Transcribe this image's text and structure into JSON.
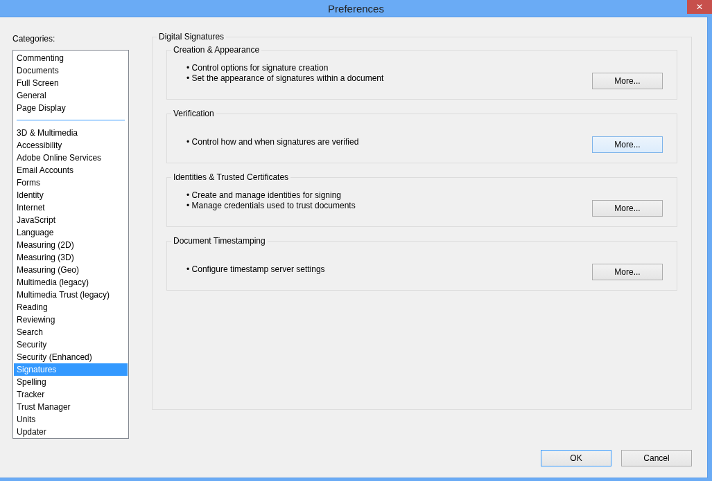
{
  "window": {
    "title": "Preferences",
    "close": "✕"
  },
  "categories": {
    "label": "Categories:",
    "groups": [
      {
        "items": [
          {
            "label": "Commenting",
            "selected": false
          },
          {
            "label": "Documents",
            "selected": false
          },
          {
            "label": "Full Screen",
            "selected": false
          },
          {
            "label": "General",
            "selected": false
          },
          {
            "label": "Page Display",
            "selected": false
          }
        ]
      },
      {
        "items": [
          {
            "label": "3D & Multimedia",
            "selected": false
          },
          {
            "label": "Accessibility",
            "selected": false
          },
          {
            "label": "Adobe Online Services",
            "selected": false
          },
          {
            "label": "Email Accounts",
            "selected": false
          },
          {
            "label": "Forms",
            "selected": false
          },
          {
            "label": "Identity",
            "selected": false
          },
          {
            "label": "Internet",
            "selected": false
          },
          {
            "label": "JavaScript",
            "selected": false
          },
          {
            "label": "Language",
            "selected": false
          },
          {
            "label": "Measuring (2D)",
            "selected": false
          },
          {
            "label": "Measuring (3D)",
            "selected": false
          },
          {
            "label": "Measuring (Geo)",
            "selected": false
          },
          {
            "label": "Multimedia (legacy)",
            "selected": false
          },
          {
            "label": "Multimedia Trust (legacy)",
            "selected": false
          },
          {
            "label": "Reading",
            "selected": false
          },
          {
            "label": "Reviewing",
            "selected": false
          },
          {
            "label": "Search",
            "selected": false
          },
          {
            "label": "Security",
            "selected": false
          },
          {
            "label": "Security (Enhanced)",
            "selected": false
          },
          {
            "label": "Signatures",
            "selected": true
          },
          {
            "label": "Spelling",
            "selected": false
          },
          {
            "label": "Tracker",
            "selected": false
          },
          {
            "label": "Trust Manager",
            "selected": false
          },
          {
            "label": "Units",
            "selected": false
          },
          {
            "label": "Updater",
            "selected": false
          }
        ]
      }
    ]
  },
  "panel": {
    "title": "Digital Signatures",
    "sections": [
      {
        "title": "Creation & Appearance",
        "lines": [
          "• Control options for signature creation",
          "• Set the appearance of signatures within a document"
        ],
        "button": {
          "label": "More...",
          "hovered": false
        }
      },
      {
        "title": "Verification",
        "lines": [
          "• Control how and when signatures are verified"
        ],
        "button": {
          "label": "More...",
          "hovered": true
        }
      },
      {
        "title": "Identities & Trusted Certificates",
        "lines": [
          "• Create and manage identities for signing",
          "• Manage credentials used to trust documents"
        ],
        "button": {
          "label": "More...",
          "hovered": false
        }
      },
      {
        "title": "Document Timestamping",
        "lines": [
          "• Configure timestamp server settings"
        ],
        "button": {
          "label": "More...",
          "hovered": false
        }
      }
    ]
  },
  "buttons": [
    {
      "label": "OK",
      "default": true
    },
    {
      "label": "Cancel",
      "default": false
    }
  ]
}
